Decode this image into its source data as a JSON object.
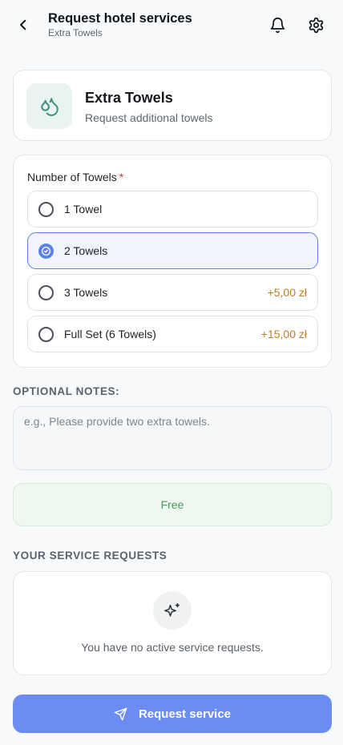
{
  "header": {
    "title": "Request hotel services",
    "subtitle": "Extra Towels"
  },
  "service": {
    "title": "Extra Towels",
    "description": "Request additional towels",
    "icon": "droplets-icon"
  },
  "towels": {
    "label": "Number of Towels",
    "required_mark": "*",
    "options": [
      {
        "label": "1 Towel",
        "price": "",
        "selected": false
      },
      {
        "label": "2 Towels",
        "price": "",
        "selected": true
      },
      {
        "label": "3 Towels",
        "price": "+5,00 zł",
        "selected": false
      },
      {
        "label": "Full Set (6 Towels)",
        "price": "+15,00 zł",
        "selected": false
      }
    ]
  },
  "notes": {
    "label": "OPTIONAL NOTES:",
    "placeholder": "e.g., Please provide two extra towels.",
    "value": ""
  },
  "price": {
    "text": "Free"
  },
  "requests": {
    "label": "YOUR SERVICE REQUESTS",
    "empty_text": "You have no active service requests.",
    "icon": "sparkles-icon"
  },
  "submit": {
    "label": "Request service",
    "icon": "send-icon"
  },
  "colors": {
    "accent": "#5b80e8",
    "button": "#6b8cf2",
    "price_extra": "#c47b22",
    "free_green": "#4a9a5c",
    "icon_teal": "#3f8f7f"
  }
}
